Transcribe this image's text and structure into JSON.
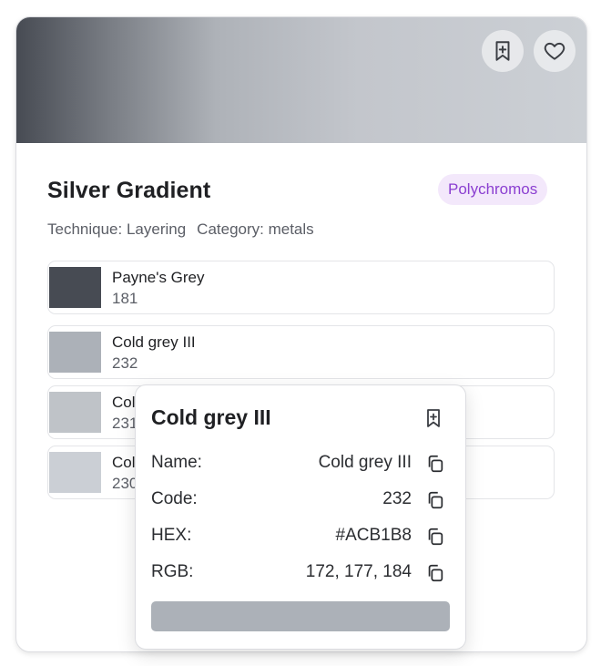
{
  "card": {
    "title": "Silver Gradient",
    "brand_badge": "Polychromos",
    "technique": "Technique: Layering",
    "category": "Category: metals",
    "actions": {
      "bookmark_icon": "bookmark-plus-icon",
      "favorite_icon": "heart-icon"
    }
  },
  "colors": [
    {
      "name": "Payne's Grey",
      "code": "181",
      "hex": "#474B53"
    },
    {
      "name": "Cold grey III",
      "code": "232",
      "hex": "#ACB1B8"
    },
    {
      "name": "Col",
      "code": "231",
      "hex": "#BFC3C8"
    },
    {
      "name": "Col",
      "code": "230",
      "hex": "#CBCFD5"
    }
  ],
  "popover": {
    "title": "Cold grey III",
    "rows": [
      {
        "label": "Name:",
        "value": "Cold grey III"
      },
      {
        "label": "Code:",
        "value": "232"
      },
      {
        "label": "HEX:",
        "value": "#ACB1B8"
      },
      {
        "label": "RGB:",
        "value": "172, 177, 184"
      }
    ],
    "swatch_color": "#ACB1B8",
    "bookmark_icon": "bookmark-plus-icon",
    "copy_icon": "copy-icon"
  },
  "theme": {
    "badge_bg": "#F3E8FB",
    "badge_text": "#8B3FD1"
  }
}
